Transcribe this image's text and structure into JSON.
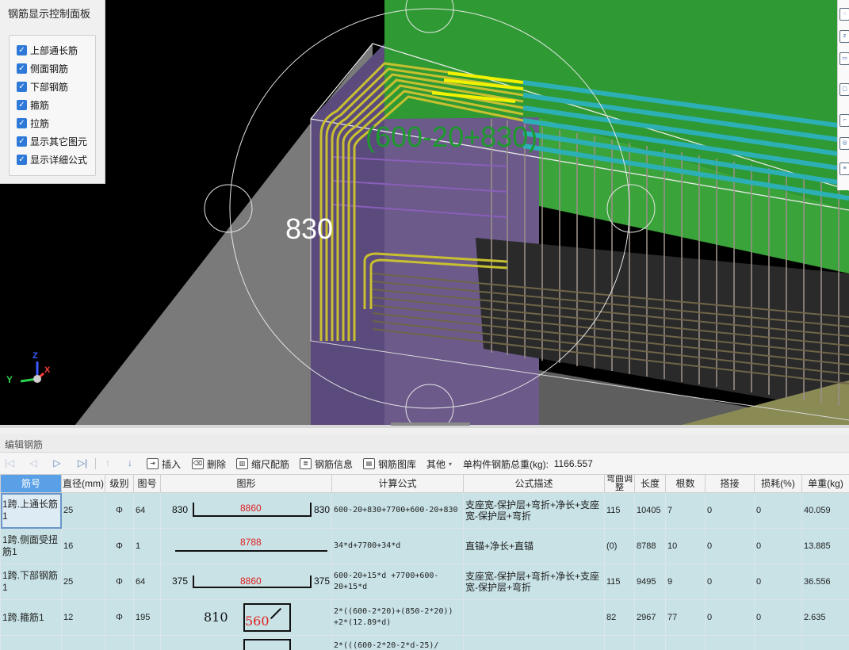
{
  "control_panel": {
    "title": "钢筋显示控制面板",
    "options": [
      {
        "label": "上部通长筋",
        "checked": true
      },
      {
        "label": "侧面钢筋",
        "checked": true
      },
      {
        "label": "下部钢筋",
        "checked": true
      },
      {
        "label": "箍筋",
        "checked": true
      },
      {
        "label": "拉筋",
        "checked": true
      },
      {
        "label": "显示其它图元",
        "checked": true
      },
      {
        "label": "显示详细公式",
        "checked": true
      }
    ]
  },
  "viewport": {
    "dimension_label": "830",
    "formula_label": "(600-20+830)",
    "axes": {
      "x": "X",
      "y": "Y",
      "z": "Z"
    },
    "colors": {
      "top_bar": "#c8c030",
      "top_bar_highlight": "#f2f200",
      "stirrup": "#8a7c73",
      "beam_top": "#2f9a33",
      "column": "#6b5a8a",
      "side_bar": "#2cb0b5"
    }
  },
  "edit_panel": {
    "title": "编辑钢筋",
    "toolbar": {
      "insert": "插入",
      "delete": "删除",
      "scale_config": "缩尺配筋",
      "rebar_info": "钢筋信息",
      "rebar_library": "钢筋图库",
      "other": "其他",
      "total_weight_label": "单构件钢筋总重(kg):",
      "total_weight_value": "1166.557"
    },
    "columns": [
      "筋号",
      "直径(mm)",
      "级别",
      "图号",
      "图形",
      "计算公式",
      "公式描述",
      "弯曲调整",
      "长度",
      "根数",
      "搭接",
      "损耗(%)",
      "单重(kg)"
    ],
    "rows": [
      {
        "name": "1跨.上通长筋1",
        "diameter": "25",
        "grade": "Φ",
        "fig_no": "64",
        "shape_left": "830",
        "shape_mid": "8860",
        "shape_right": "830",
        "formula": "600-20+830+7700+600-20+830",
        "desc": "支座宽-保护层+弯折+净长+支座宽-保护层+弯折",
        "bend": "115",
        "length": "10405",
        "count": "7",
        "lap": "0",
        "loss": "0",
        "unit_weight": "40.059"
      },
      {
        "name": "1跨.侧面受扭筋1",
        "diameter": "16",
        "grade": "Φ",
        "fig_no": "1",
        "shape_left": "",
        "shape_mid": "8788",
        "shape_right": "",
        "formula": "34*d+7700+34*d",
        "desc": "直锚+净长+直锚",
        "bend": "(0)",
        "length": "8788",
        "count": "10",
        "lap": "0",
        "loss": "0",
        "unit_weight": "13.885"
      },
      {
        "name": "1跨.下部钢筋1",
        "diameter": "25",
        "grade": "Φ",
        "fig_no": "64",
        "shape_left": "375",
        "shape_mid": "8860",
        "shape_right": "375",
        "formula": "600-20+15*d +7700+600-20+15*d",
        "desc": "支座宽-保护层+弯折+净长+支座宽-保护层+弯折",
        "bend": "115",
        "length": "9495",
        "count": "9",
        "lap": "0",
        "loss": "0",
        "unit_weight": "36.556"
      },
      {
        "name": "1跨.箍筋1",
        "diameter": "12",
        "grade": "Φ",
        "fig_no": "195",
        "shape_left": "810",
        "shape_mid": "560",
        "shape_right": "",
        "formula": "2*((600-2*20)+(850-2*20)) +2*(12.89*d)",
        "desc": "",
        "bend": "82",
        "length": "2967",
        "count": "77",
        "lap": "0",
        "loss": "0",
        "unit_weight": "2.635"
      },
      {
        "name": "",
        "diameter": "",
        "grade": "",
        "fig_no": "",
        "shape_left": "",
        "shape_mid": "",
        "shape_right": "",
        "formula": "2*(((600-2*20-2*d-25)/",
        "desc": "",
        "bend": "",
        "length": "",
        "count": "",
        "lap": "",
        "loss": "",
        "unit_weight": ""
      }
    ]
  }
}
